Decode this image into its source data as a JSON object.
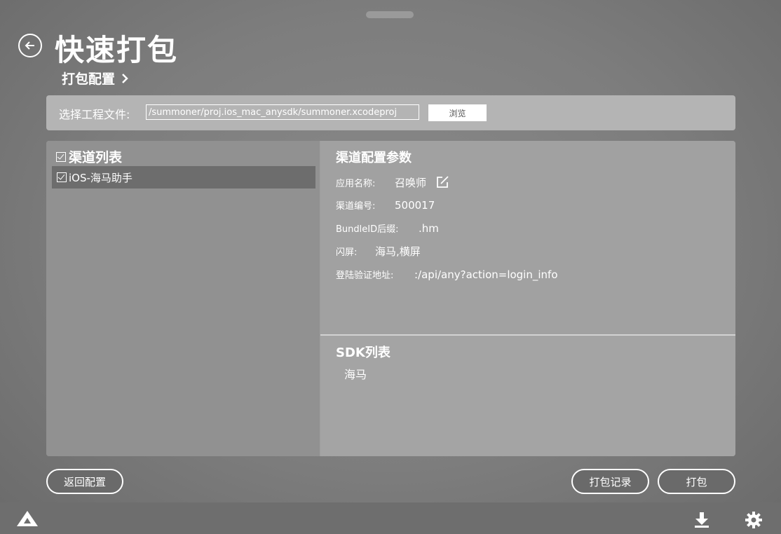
{
  "header": {
    "title": "快速打包",
    "breadcrumb": "打包配置",
    "back_icon": "back-arrow-circle-icon"
  },
  "file_select": {
    "label": "选择工程文件:",
    "path_value": "/summoner/proj.ios_mac_anysdk/summoner.xcodeproj",
    "browse_label": "浏览"
  },
  "channel_list": {
    "header": "渠道列表",
    "header_checked": true,
    "items": [
      {
        "label": "iOS-海马助手",
        "checked": true,
        "selected": true
      }
    ]
  },
  "channel_params": {
    "title": "渠道配置参数",
    "rows": [
      {
        "label": "应用名称:",
        "value": "召唤师"
      },
      {
        "label": "渠道编号:",
        "value": "500017"
      },
      {
        "label": "BundleID后缀:",
        "value": ".hm"
      },
      {
        "label": "闪屏:",
        "value": "海马,横屏"
      },
      {
        "label": "登陆验证地址:",
        "value": ":/api/any?action=login_info"
      }
    ]
  },
  "sdk_list": {
    "title": "SDK列表",
    "items": [
      "海马"
    ]
  },
  "buttons": {
    "back_config": "返回配置",
    "pack_history": "打包记录",
    "pack": "打包"
  },
  "bottom_bar": {
    "icons": [
      "anysdk-logo-icon",
      "download-icon",
      "settings-gear-icon"
    ]
  },
  "colors": {
    "panel_left": "#919191",
    "selected_row": "#6d6d6d",
    "file_bar": "#b4b4b4",
    "bottom_bar": "#6e6e6e"
  }
}
